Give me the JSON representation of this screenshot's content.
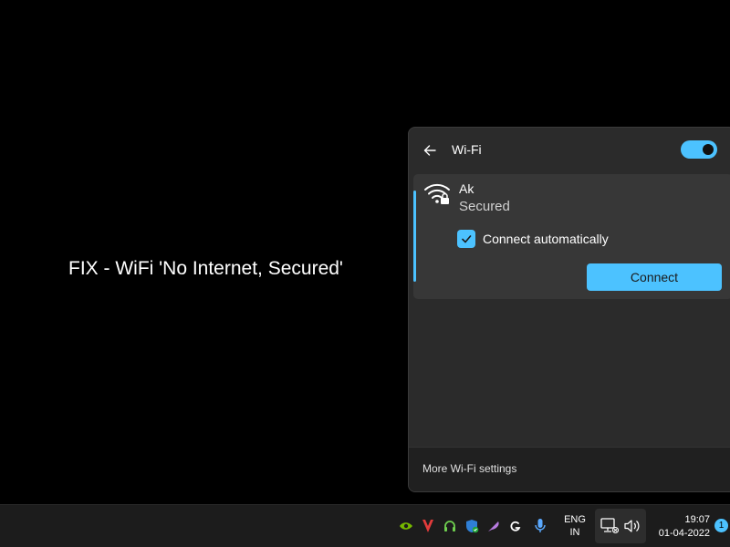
{
  "overlay": {
    "title": "FIX - WiFi 'No Internet, Secured'"
  },
  "flyout": {
    "header": {
      "back_icon": "back-arrow-icon",
      "title": "Wi-Fi",
      "wifi_enabled": true
    },
    "network": {
      "name": "Ak",
      "status": "Secured",
      "icon": "wifi-secured-icon",
      "connect_automatically": {
        "label": "Connect automatically",
        "checked": true
      },
      "connect_button": "Connect"
    },
    "footer": {
      "more_settings": "More Wi-Fi settings"
    }
  },
  "taskbar": {
    "tray_icons": [
      "nvidia-icon",
      "antivirus-icon",
      "headset-icon",
      "windows-security-icon",
      "feather-icon",
      "logitech-icon",
      "microphone-icon"
    ],
    "language": {
      "line1": "ENG",
      "line2": "IN"
    },
    "status_icons": [
      "network-icon",
      "volume-icon"
    ],
    "clock": {
      "time": "19:07",
      "date": "01-04-2022"
    },
    "notifications": "1"
  },
  "colors": {
    "accent": "#4cc2ff",
    "flyout_bg": "#2b2b2b",
    "card_bg": "#373737",
    "taskbar_bg": "#1c1c1c"
  }
}
